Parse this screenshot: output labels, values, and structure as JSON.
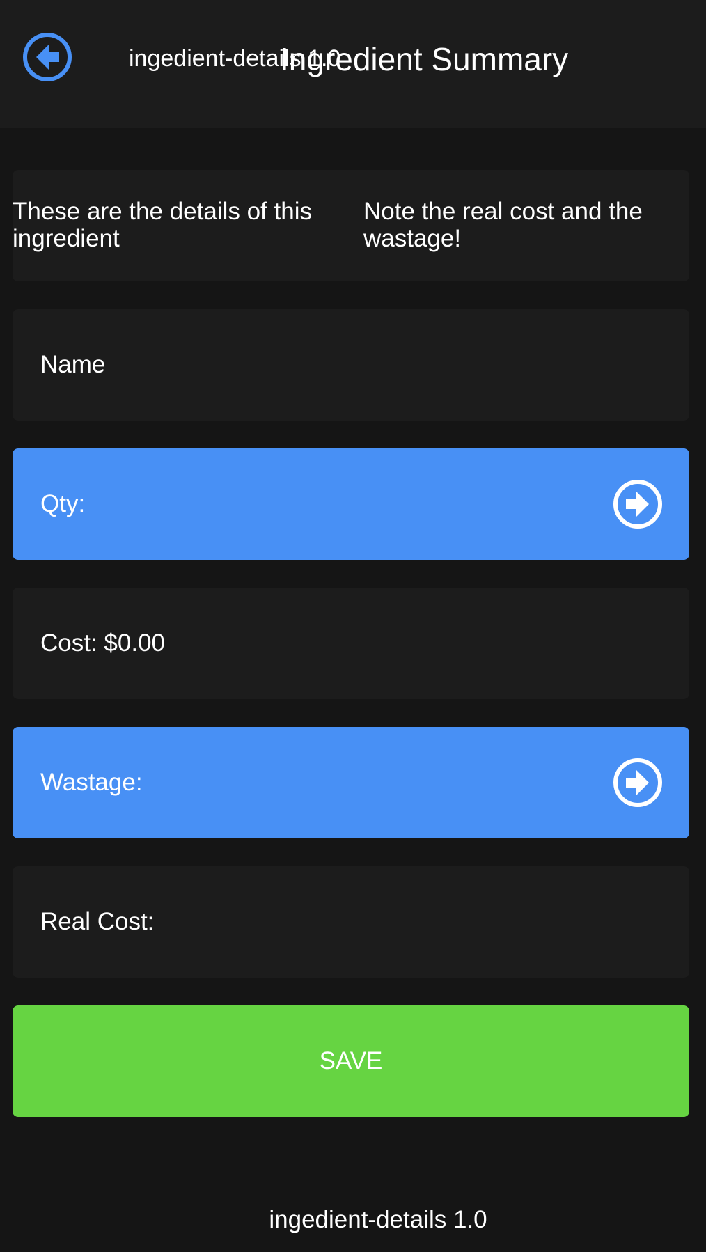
{
  "header": {
    "subtitle": "ingedient-details 1.0",
    "title": "Ingredient Summary",
    "back_icon": "arrow-circle-left-icon",
    "accent_color": "#4890f5"
  },
  "info": {
    "left_text": "These are the details of this ingredient",
    "right_text": "Note the real cost and the wastage!"
  },
  "rows": {
    "name_label": "Name",
    "qty_label": "Qty:",
    "cost_label": "Cost: $0.00",
    "wastage_label": "Wastage:",
    "real_cost_label": "Real Cost:",
    "arrow_icon": "arrow-circle-right-icon",
    "row_color": "#1c1c1c",
    "accent_row_color": "#4890f5"
  },
  "save": {
    "label": "SAVE",
    "color": "#66d442"
  },
  "footer": {
    "text": "ingedient-details 1.0"
  }
}
